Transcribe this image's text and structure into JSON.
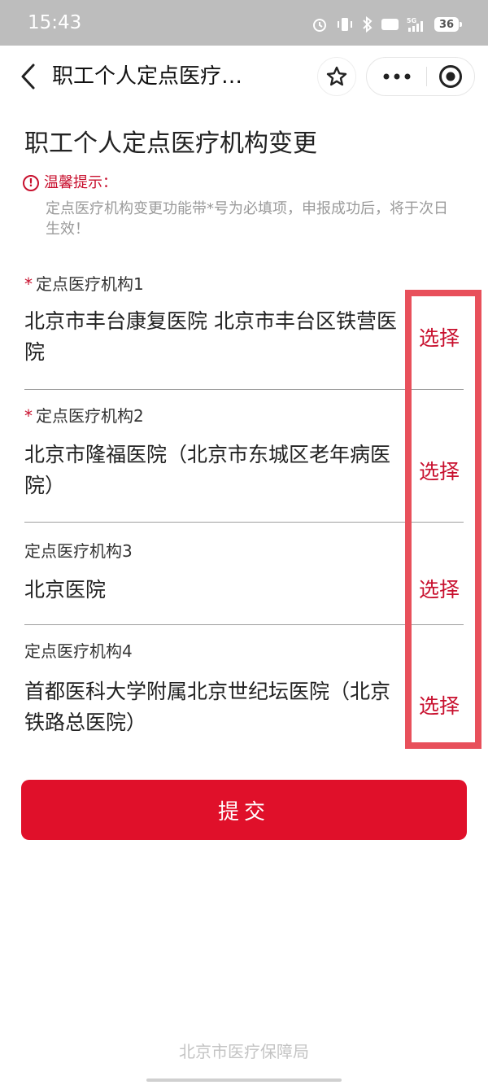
{
  "status_bar": {
    "time": "15:43",
    "network": "5G",
    "hd": "HD",
    "battery": "36"
  },
  "nav": {
    "title": "职工个人定点医疗…",
    "icons": {
      "back": "back-arrow-icon",
      "star": "star-icon",
      "more": "more-icon",
      "close": "close-target-icon"
    }
  },
  "page": {
    "title": "职工个人定点医疗机构变更"
  },
  "tip": {
    "label": "温馨提示：",
    "text": "定点医疗机构变更功能带*号为必填项，申报成功后，将于次日生效！"
  },
  "fields": [
    {
      "required": "*",
      "label": "定点医疗机构1",
      "value": "北京市丰台康复医院 北京市丰台区铁营医院",
      "action": "选择"
    },
    {
      "required": "*",
      "label": "定点医疗机构2",
      "value": "北京市隆福医院（北京市东城区老年病医院）",
      "action": "选择"
    },
    {
      "required": "",
      "label": "定点医疗机构3",
      "value": "北京医院",
      "action": "选择"
    },
    {
      "required": "",
      "label": "定点医疗机构4",
      "value": "首都医科大学附属北京世纪坛医院（北京铁路总医院）",
      "action": "选择"
    }
  ],
  "submit": {
    "label": "提交"
  },
  "footer": {
    "text": "北京市医疗保障局"
  },
  "colors": {
    "accent": "#e0102a",
    "accent_text": "#c8102e",
    "highlight": "#e8505b",
    "status_bar": "#bdbdbd"
  }
}
